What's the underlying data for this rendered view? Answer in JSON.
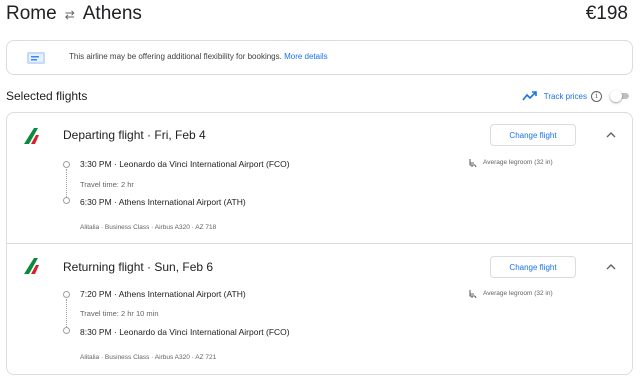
{
  "header": {
    "origin": "Rome",
    "destination": "Athens",
    "price": "€198"
  },
  "notice": {
    "text": "This airline may be offering additional flexibility for bookings.",
    "link": "More details"
  },
  "selected": {
    "title": "Selected flights",
    "track_label": "Track prices",
    "info_glyph": "i"
  },
  "departing": {
    "title": "Departing flight · Fri, Feb 4",
    "change_label": "Change flight",
    "depart_line": "3:30 PM · Leonardo da Vinci International Airport (FCO)",
    "travel_time": "Travel time: 2 hr",
    "arrive_line": "6:30 PM · Athens International Airport (ATH)",
    "details": "Alitalia · Business Class · Airbus A320 · AZ 718",
    "legroom": "Average legroom (32 in)"
  },
  "returning": {
    "title": "Returning flight · Sun, Feb 6",
    "change_label": "Change flight",
    "depart_line": "7:20 PM · Athens International Airport (ATH)",
    "travel_time": "Travel time: 2 hr 10 min",
    "arrive_line": "8:30 PM · Leonardo da Vinci International Airport (FCO)",
    "details": "Alitalia · Business Class · Airbus A320 · AZ 721",
    "legroom": "Average legroom (32 in)"
  },
  "icons": {
    "swap": "swap-arrows-icon",
    "ticket": "ticket-icon",
    "trend": "trending-icon",
    "info": "info-icon",
    "airline_logo": "alitalia-logo",
    "seat": "seat-icon",
    "chevron": "chevron-up-icon"
  },
  "colors": {
    "accent": "#1a73e8",
    "text": "#202124",
    "muted": "#5f6368",
    "border": "#dadce0",
    "logo_green": "#0b8a3e",
    "logo_red": "#d81e2a"
  }
}
